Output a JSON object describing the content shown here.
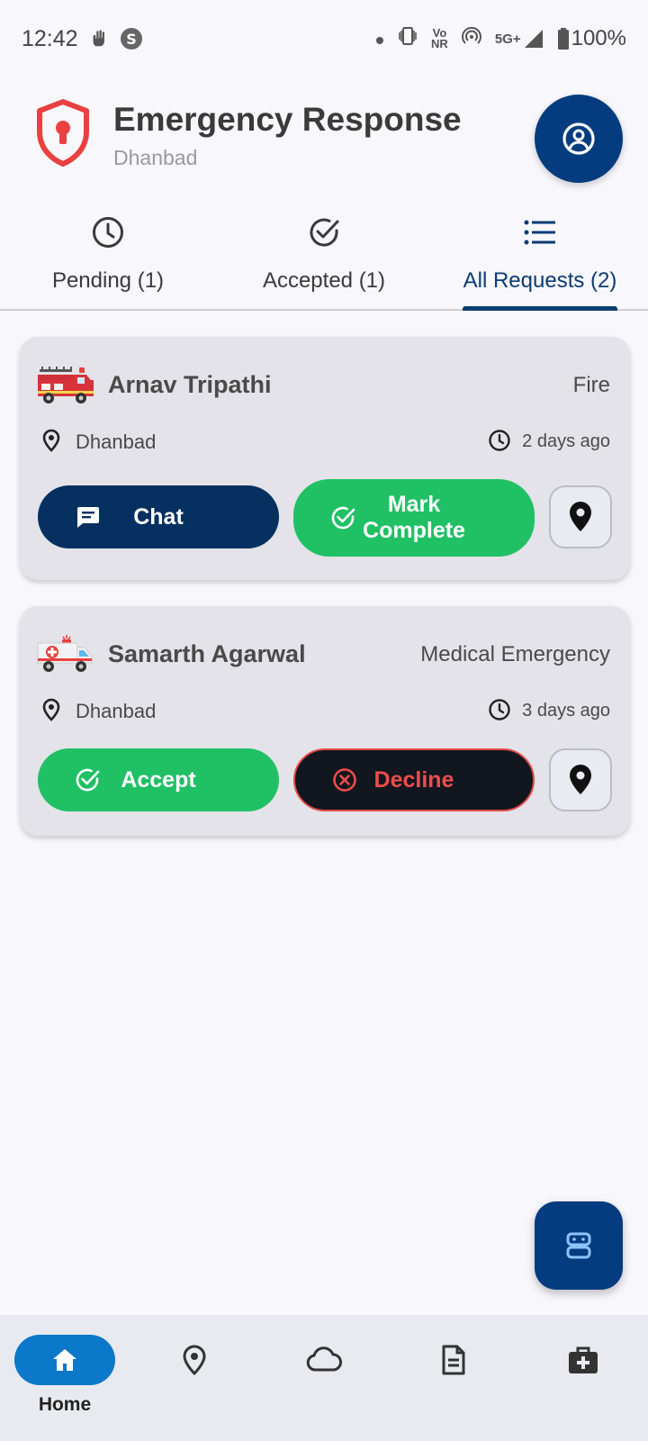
{
  "status_bar": {
    "time": "12:42",
    "network_label_top": "Vo",
    "network_label_bottom": "NR",
    "signal_type": "5G+",
    "battery": "100%"
  },
  "header": {
    "title": "Emergency Response",
    "subtitle": "Dhanbad"
  },
  "tabs": [
    {
      "label": "Pending (1)",
      "icon": "clock-icon",
      "active": false
    },
    {
      "label": "Accepted (1)",
      "icon": "check-circle-icon",
      "active": false
    },
    {
      "label": "All Requests (2)",
      "icon": "list-icon",
      "active": true
    }
  ],
  "requests": [
    {
      "name": "Arnav  Tripathi",
      "type": "Fire",
      "vehicle_icon": "fire-truck-icon",
      "location": "Dhanbad",
      "time": "2 days ago",
      "primary_button": "Chat",
      "secondary_button_line1": "Mark",
      "secondary_button_line2": "Complete"
    },
    {
      "name": "Samarth Agarwal",
      "type": "Medical Emergency",
      "vehicle_icon": "ambulance-icon",
      "location": "Dhanbad",
      "time": "3 days ago",
      "primary_button": "Accept",
      "secondary_button": "Decline"
    }
  ],
  "bottom_nav": [
    {
      "label": "Home",
      "icon": "home-icon",
      "active": true
    },
    {
      "label": "",
      "icon": "map-pin-icon",
      "active": false
    },
    {
      "label": "",
      "icon": "cloud-icon",
      "active": false
    },
    {
      "label": "",
      "icon": "document-icon",
      "active": false
    },
    {
      "label": "",
      "icon": "first-aid-kit-icon",
      "active": false
    }
  ],
  "colors": {
    "primary_navy": "#053c80",
    "accept_green": "#20c065",
    "decline_red": "#ef4c4c",
    "shield_red": "#e8413f",
    "nav_active": "#0b78c9"
  }
}
